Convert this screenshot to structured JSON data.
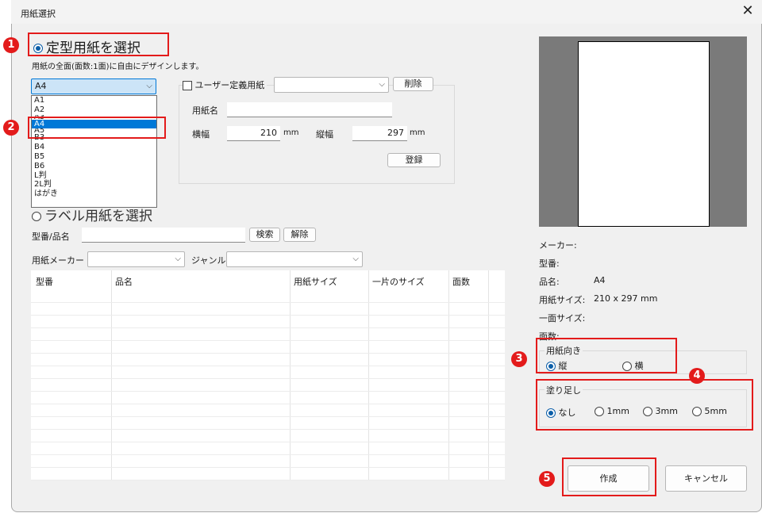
{
  "window": {
    "title": "用紙選択"
  },
  "standard": {
    "radio_label": "定型用紙を選択",
    "description": "用紙の全面(面数:1面)に自由にデザインします。",
    "selected": "A4",
    "options": [
      "A1",
      "A2",
      "A3",
      "A4",
      "A5",
      "B3",
      "B4",
      "B5",
      "B6",
      "L判",
      "2L判",
      "はがき"
    ]
  },
  "user_defined": {
    "checkbox_label": "ユーザー定義用紙",
    "delete_label": "削除",
    "name_label": "用紙名",
    "width_label": "横幅",
    "width_value": "210",
    "height_label": "縦幅",
    "height_value": "297",
    "unit": "mm",
    "register_label": "登録"
  },
  "label": {
    "radio_label": "ラベル用紙を選択",
    "model_label": "型番/品名",
    "search_label": "検索",
    "clear_label": "解除",
    "maker_label": "用紙メーカー",
    "genre_label": "ジャンル"
  },
  "table": {
    "columns": [
      "型番",
      "品名",
      "用紙サイズ",
      "一片のサイズ",
      "面数"
    ]
  },
  "info": {
    "maker_label": "メーカー:",
    "model_label": "型番:",
    "name_label": "品名:",
    "name_value": "A4",
    "size_label": "用紙サイズ:",
    "size_value": "210 x 297 mm",
    "piece_label": "一面サイズ:",
    "count_label": "面数:"
  },
  "orientation": {
    "title": "用紙向き",
    "portrait": "縦",
    "landscape": "横",
    "selected": "縦"
  },
  "bleed": {
    "title": "塗り足し",
    "options": [
      "なし",
      "1mm",
      "3mm",
      "5mm"
    ],
    "selected": "なし"
  },
  "buttons": {
    "create": "作成",
    "cancel": "キャンセル"
  },
  "badges": [
    "1",
    "2",
    "3",
    "4",
    "5"
  ],
  "colors": {
    "annotation": "#e31b1b",
    "selection": "#0078d7",
    "radio_accent": "#0b5ea8"
  }
}
